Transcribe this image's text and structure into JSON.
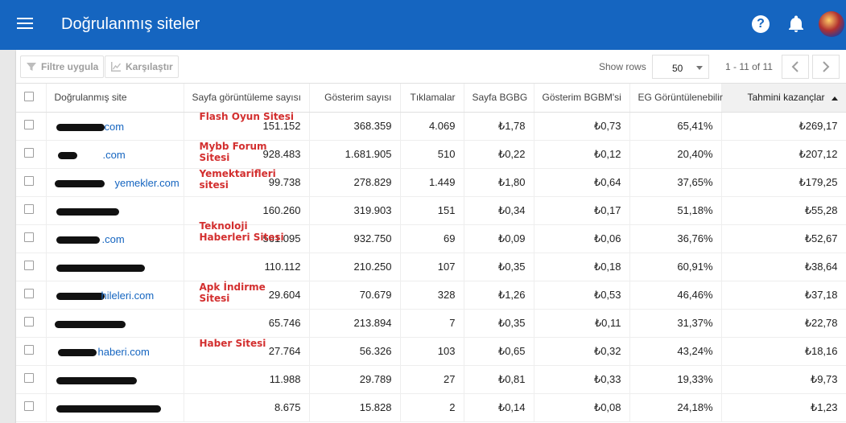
{
  "header": {
    "title": "Doğrulanmış siteler",
    "colors": {
      "bar": "#1565c0"
    }
  },
  "toolbar": {
    "filter_label": "Filtre uygula",
    "compare_label": "Karşılaştır",
    "show_rows_label": "Show rows",
    "rows_value": "50",
    "range_label": "1 - 11 of 11"
  },
  "table": {
    "columns": [
      "Doğrulanmış site",
      "Sayfa görüntüleme sayısı",
      "Gösterim sayısı",
      "Tıklamalar",
      "Sayfa BGBG",
      "Gösterim BGBM'si",
      "EG Görüntülenebilir",
      "Tahmini kazançlar"
    ],
    "rows": [
      {
        "site": "com",
        "annotation": "Flash Oyun Sitesi",
        "pageviews": "151.152",
        "impressions": "368.359",
        "clicks": "4.069",
        "page_rpm": "₺1,78",
        "imp_rpm": "₺0,73",
        "viewable": "65,41%",
        "earnings": "₺269,17"
      },
      {
        "site": ".com",
        "annotation": "Mybb Forum Sitesi",
        "pageviews": "928.483",
        "impressions": "1.681.905",
        "clicks": "510",
        "page_rpm": "₺0,22",
        "imp_rpm": "₺0,12",
        "viewable": "20,40%",
        "earnings": "₺207,12"
      },
      {
        "site": "yemekler.com",
        "annotation": "Yemektarifleri sitesi",
        "pageviews": "99.738",
        "impressions": "278.829",
        "clicks": "1.449",
        "page_rpm": "₺1,80",
        "imp_rpm": "₺0,64",
        "viewable": "37,65%",
        "earnings": "₺179,25"
      },
      {
        "site": "",
        "annotation": "",
        "pageviews": "160.260",
        "impressions": "319.903",
        "clicks": "151",
        "page_rpm": "₺0,34",
        "imp_rpm": "₺0,17",
        "viewable": "51,18%",
        "earnings": "₺55,28"
      },
      {
        "site": ".com",
        "annotation": "Teknoloji Haberleri Sitesi",
        "pageviews": "561.095",
        "impressions": "932.750",
        "clicks": "69",
        "page_rpm": "₺0,09",
        "imp_rpm": "₺0,06",
        "viewable": "36,76%",
        "earnings": "₺52,67"
      },
      {
        "site": "",
        "annotation": "",
        "pageviews": "110.112",
        "impressions": "210.250",
        "clicks": "107",
        "page_rpm": "₺0,35",
        "imp_rpm": "₺0,18",
        "viewable": "60,91%",
        "earnings": "₺38,64"
      },
      {
        "site": "hileleri.com",
        "annotation": "Apk İndirme Sitesi",
        "pageviews": "29.604",
        "impressions": "70.679",
        "clicks": "328",
        "page_rpm": "₺1,26",
        "imp_rpm": "₺0,53",
        "viewable": "46,46%",
        "earnings": "₺37,18"
      },
      {
        "site": "",
        "annotation": "",
        "pageviews": "65.746",
        "impressions": "213.894",
        "clicks": "7",
        "page_rpm": "₺0,35",
        "imp_rpm": "₺0,11",
        "viewable": "31,37%",
        "earnings": "₺22,78"
      },
      {
        "site": "haberi.com",
        "annotation": "Haber Sitesi",
        "pageviews": "27.764",
        "impressions": "56.326",
        "clicks": "103",
        "page_rpm": "₺0,65",
        "imp_rpm": "₺0,32",
        "viewable": "43,24%",
        "earnings": "₺18,16"
      },
      {
        "site": "",
        "annotation": "",
        "pageviews": "11.988",
        "impressions": "29.789",
        "clicks": "27",
        "page_rpm": "₺0,81",
        "imp_rpm": "₺0,33",
        "viewable": "19,33%",
        "earnings": "₺9,73"
      },
      {
        "site": "",
        "annotation": "",
        "pageviews": "8.675",
        "impressions": "15.828",
        "clicks": "2",
        "page_rpm": "₺0,14",
        "imp_rpm": "₺0,08",
        "viewable": "24,18%",
        "earnings": "₺1,23"
      }
    ]
  }
}
